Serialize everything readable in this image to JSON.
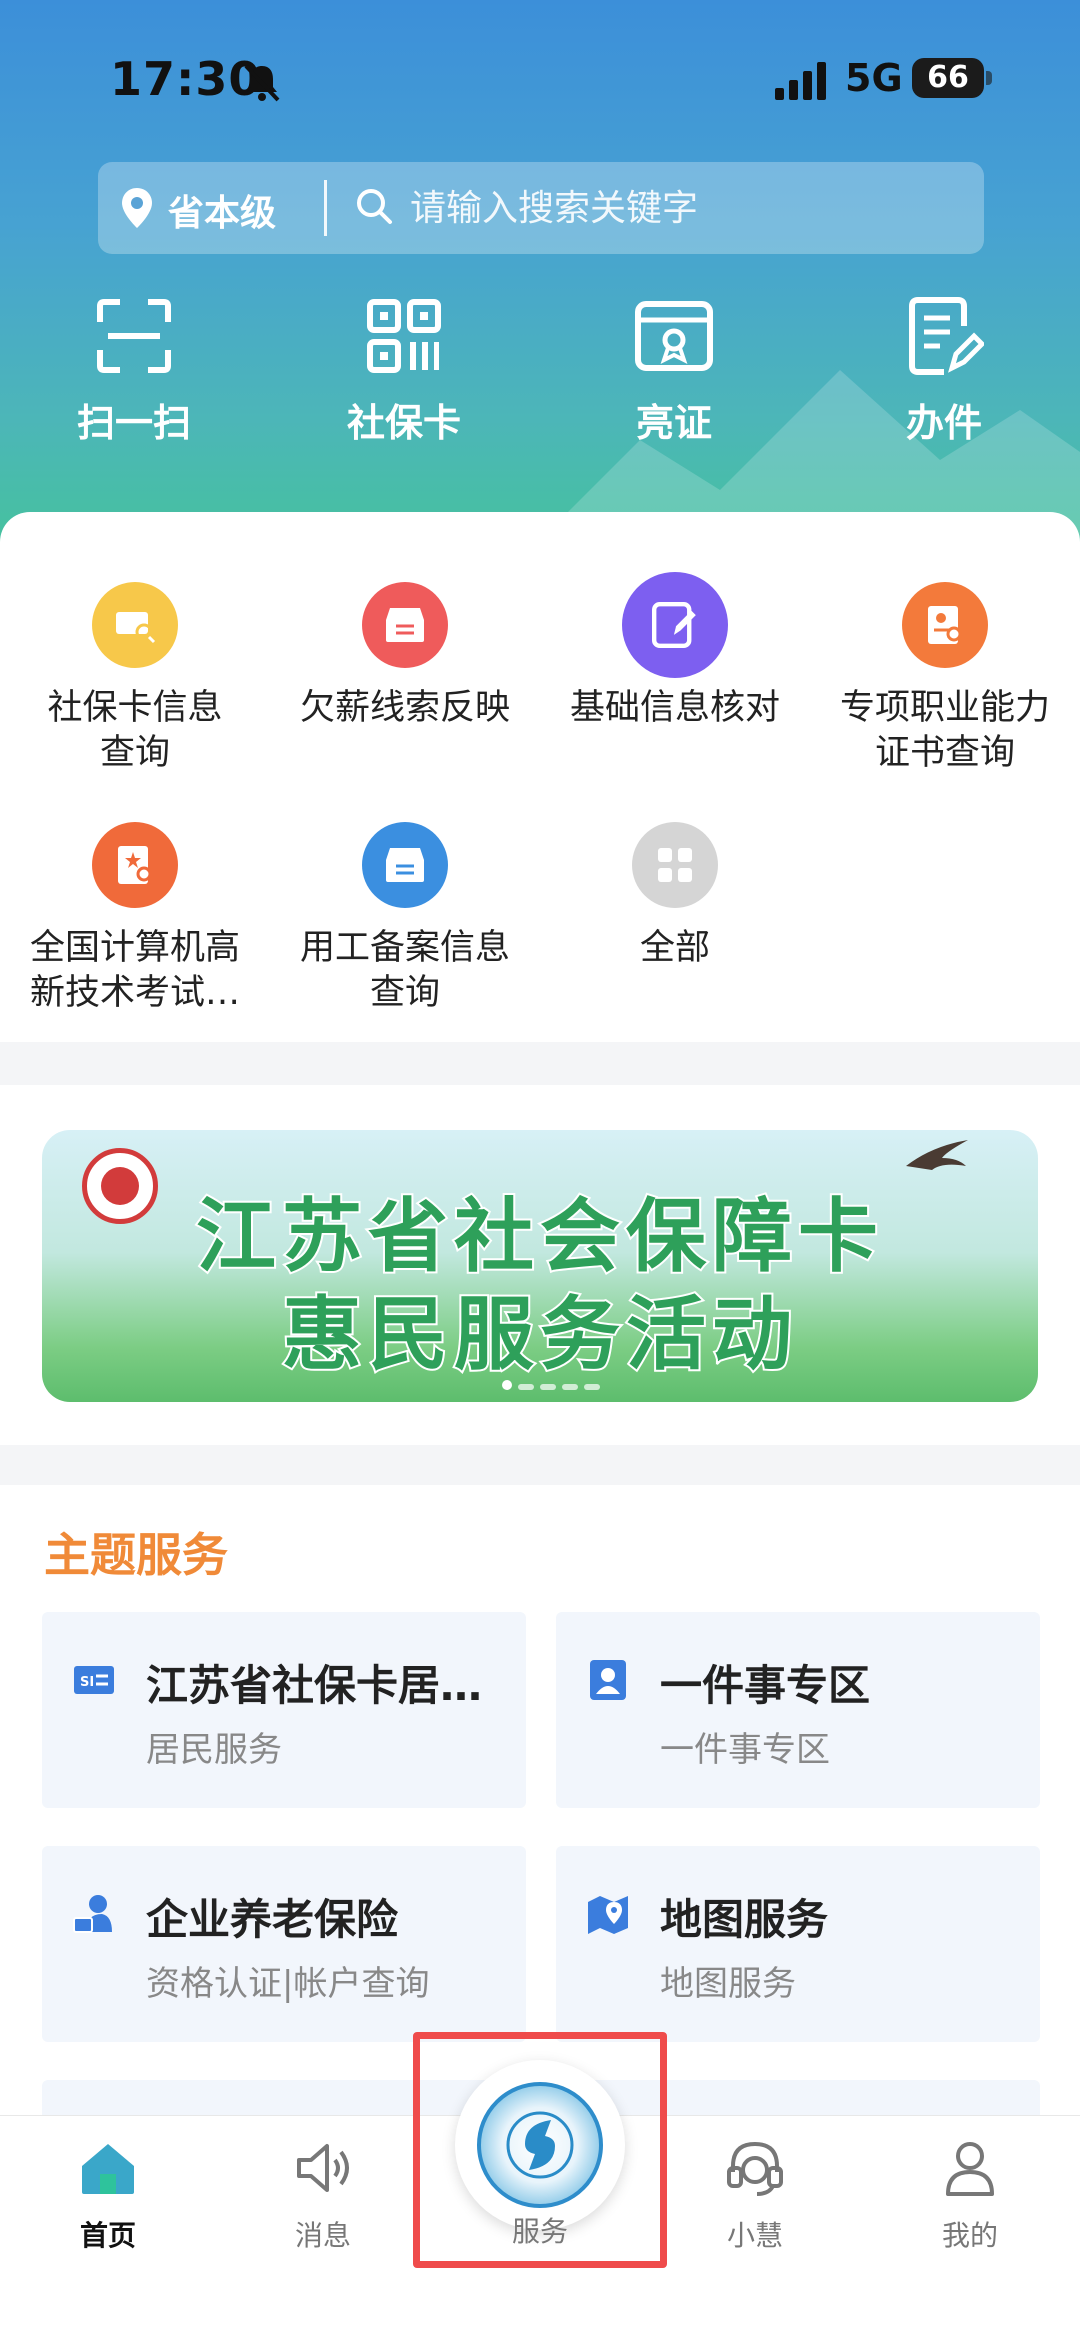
{
  "status_bar": {
    "time": "17:30",
    "network": "5G",
    "battery": "66"
  },
  "search": {
    "location": "省本级",
    "placeholder": "请输入搜索关键字"
  },
  "quick_actions": [
    {
      "label": "扫一扫",
      "icon": "scan-icon"
    },
    {
      "label": "社保卡",
      "icon": "qr-code-icon"
    },
    {
      "label": "亮证",
      "icon": "certificate-icon"
    },
    {
      "label": "办件",
      "icon": "edit-document-icon"
    }
  ],
  "services": [
    {
      "line1": "社保卡信息",
      "line2": "查询",
      "color": "#f7c84a",
      "icon": "card-search-icon"
    },
    {
      "line1": "欠薪线索反映",
      "line2": "",
      "color": "#ef5b5b",
      "icon": "inbox-icon"
    },
    {
      "line1": "基础信息核对",
      "line2": "",
      "color": "#7d5ff0",
      "icon": "edit-icon"
    },
    {
      "line1": "专项职业能力",
      "line2": "证书查询",
      "color": "#f37a3b",
      "icon": "certificate-search-icon"
    },
    {
      "line1": "全国计算机高",
      "line2": "新技术考试…",
      "color": "#f06a3a",
      "icon": "exam-search-icon"
    },
    {
      "line1": "用工备案信息",
      "line2": "查询",
      "color": "#3b8fe0",
      "icon": "inbox-icon"
    },
    {
      "line1": "全部",
      "line2": "",
      "color": "#d5d5d5",
      "icon": "grid-icon"
    }
  ],
  "banner": {
    "line1": "江苏省社会保障卡",
    "line2": "惠民服务活动"
  },
  "theme_services": {
    "title": "主题服务",
    "items": [
      {
        "title": "江苏省社保卡居…",
        "subtitle": "居民服务",
        "icon": "si-card-icon"
      },
      {
        "title": "一件事专区",
        "subtitle": "一件事专区",
        "icon": "person-badge-icon"
      },
      {
        "title": "企业养老保险",
        "subtitle": "资格认证|帐户查询",
        "icon": "pension-icon"
      },
      {
        "title": "地图服务",
        "subtitle": "地图服务",
        "icon": "map-pin-icon"
      }
    ]
  },
  "tabbar": {
    "home": "首页",
    "messages": "消息",
    "service": "服务",
    "assistant": "小慧",
    "mine": "我的"
  },
  "colors": {
    "accent_orange": "#f08a38",
    "highlight_red": "#ef4b4b",
    "header_blue": "#3c8fd9",
    "header_green": "#45c39b"
  }
}
